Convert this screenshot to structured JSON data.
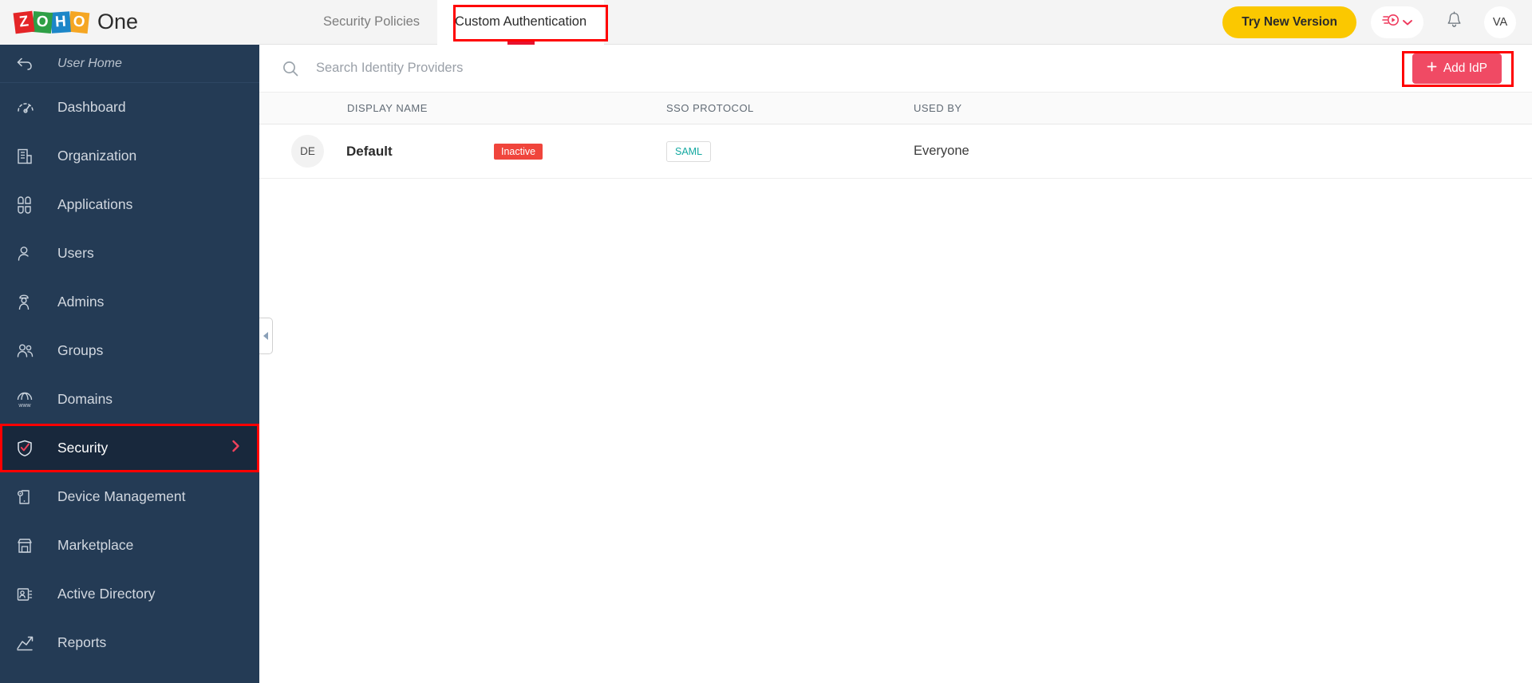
{
  "brand": {
    "logo_tiles": [
      "Z",
      "O",
      "H",
      "O"
    ],
    "product": "One",
    "colors": {
      "red": "#e42527",
      "green": "#2e9f46",
      "blue": "#1c86c8",
      "orange": "#f5a623"
    }
  },
  "header": {
    "tabs": [
      {
        "label": "Security Policies",
        "active": false
      },
      {
        "label": "Custom Authentication",
        "active": true
      }
    ],
    "try_new_version": "Try New Version",
    "video_icon": "video-play-icon",
    "video_chevron": "chevron-down-icon",
    "notifications_icon": "bell-icon",
    "avatar_initials": "VA",
    "accent_yellow": "#fbc800",
    "highlight_color": "#ff0000",
    "active_tab_underline": "#e8122d"
  },
  "sidebar": {
    "background": "#243b55",
    "home": {
      "label": "User Home",
      "icon": "back-arrow-icon"
    },
    "items": [
      {
        "label": "Dashboard",
        "icon": "gauge-icon",
        "active": false
      },
      {
        "label": "Organization",
        "icon": "building-icon",
        "active": false
      },
      {
        "label": "Applications",
        "icon": "grid-apps-icon",
        "active": false
      },
      {
        "label": "Users",
        "icon": "user-icon",
        "active": false
      },
      {
        "label": "Admins",
        "icon": "admin-user-icon",
        "active": false
      },
      {
        "label": "Groups",
        "icon": "users-group-icon",
        "active": false
      },
      {
        "label": "Domains",
        "icon": "www-globe-icon",
        "active": false
      },
      {
        "label": "Security",
        "icon": "shield-check-icon",
        "active": true,
        "chevron": "chevron-right-icon"
      },
      {
        "label": "Device Management",
        "icon": "device-gear-icon",
        "active": false
      },
      {
        "label": "Marketplace",
        "icon": "store-icon",
        "active": false
      },
      {
        "label": "Active Directory",
        "icon": "contact-card-icon",
        "active": false
      },
      {
        "label": "Reports",
        "icon": "chart-up-icon",
        "active": false
      }
    ],
    "collapse_handle_icon": "chevron-left-icon"
  },
  "main": {
    "search": {
      "placeholder": "Search Identity Providers",
      "value": "",
      "icon": "search-icon"
    },
    "add_idp": {
      "label": "Add IdP",
      "plus_icon": "plus-icon",
      "color": "#f04a64"
    },
    "table": {
      "columns": [
        "DISPLAY NAME",
        "SSO PROTOCOL",
        "USED BY"
      ],
      "rows": [
        {
          "avatar": "DE",
          "display_name": "Default",
          "status": "Inactive",
          "status_color": "#f0453c",
          "sso_protocol": "SAML",
          "sso_protocol_color": "#13a8a0",
          "used_by": "Everyone"
        }
      ]
    }
  }
}
